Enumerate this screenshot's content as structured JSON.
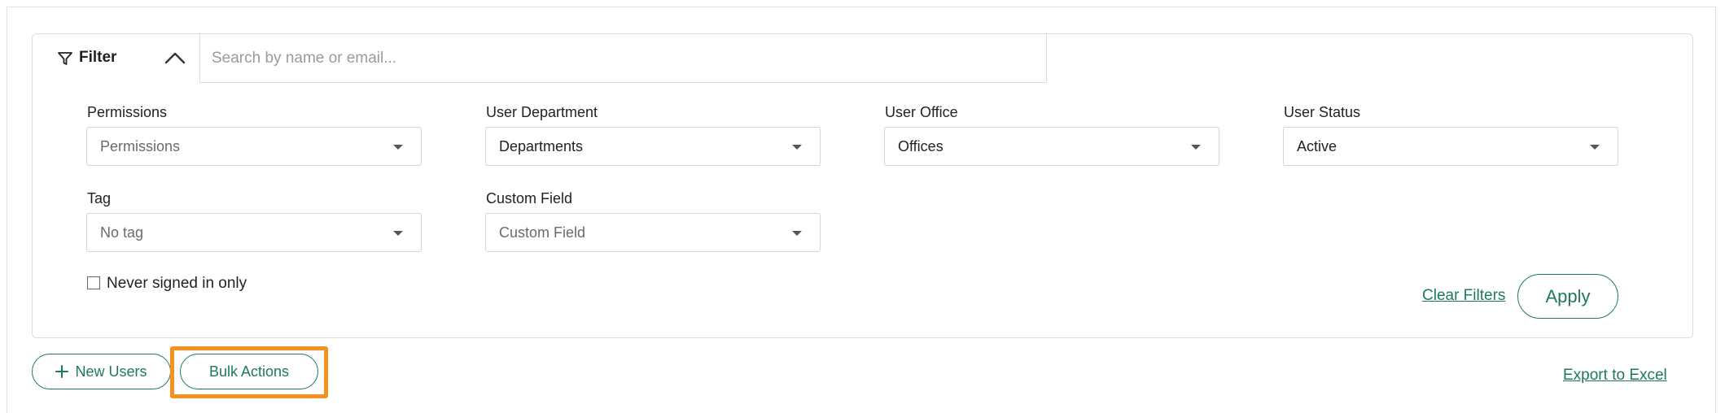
{
  "filter": {
    "tab_label": "Filter",
    "search_placeholder": "Search by name or email...",
    "search_value": "",
    "fields": {
      "permissions": {
        "label": "Permissions",
        "value": "Permissions"
      },
      "department": {
        "label": "User Department",
        "value": "Departments"
      },
      "office": {
        "label": "User Office",
        "value": "Offices"
      },
      "status": {
        "label": "User Status",
        "value": "Active"
      },
      "tag": {
        "label": "Tag",
        "value": "No tag"
      },
      "custom_field": {
        "label": "Custom Field",
        "value": "Custom Field"
      }
    },
    "never_signed_in_label": "Never signed in only",
    "never_signed_in_checked": false,
    "clear_label": "Clear Filters",
    "apply_label": "Apply"
  },
  "actions": {
    "new_users_label": "New Users",
    "bulk_actions_label": "Bulk Actions",
    "export_label": "Export to Excel"
  },
  "colors": {
    "accent": "#1c7a5a",
    "highlight": "#f7901e",
    "border": "#dcdcdc"
  },
  "icons": {
    "filter": "funnel-icon",
    "collapse": "chevron-up-icon",
    "dropdown": "caret-down-icon",
    "add": "plus-icon"
  }
}
